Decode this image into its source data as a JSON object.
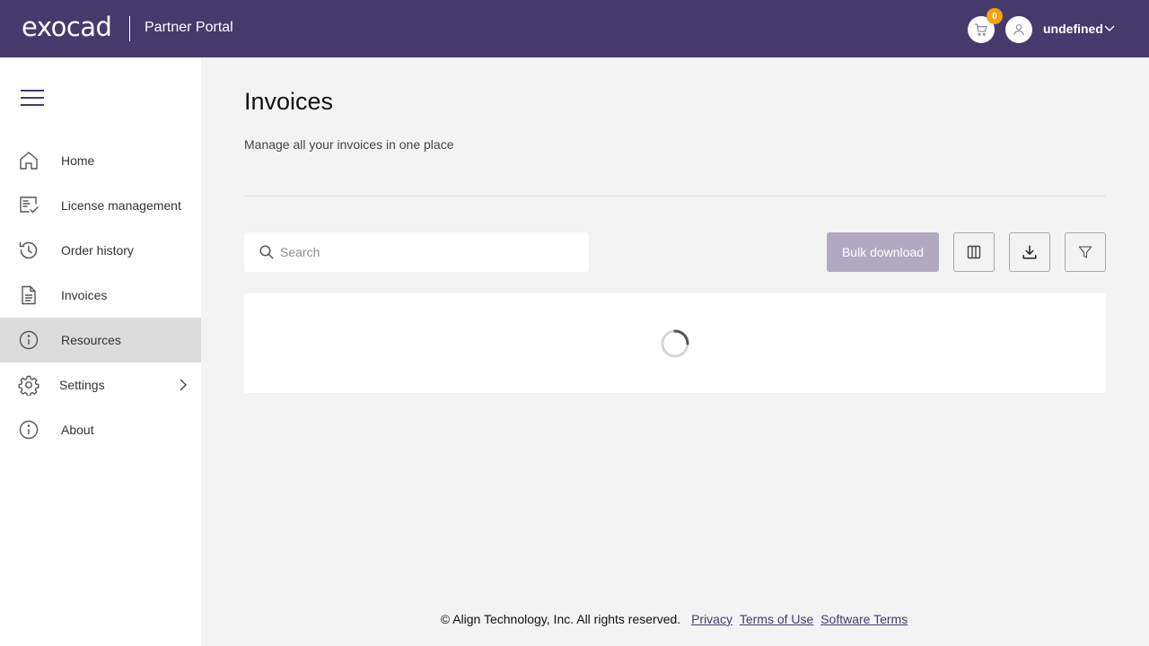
{
  "header": {
    "brand": "exocad",
    "portal_title": "Partner Portal",
    "cart_count": "0",
    "user_name": "undefined"
  },
  "sidebar": {
    "items": [
      {
        "label": "Home",
        "icon": "home-icon"
      },
      {
        "label": "License management",
        "icon": "license-icon"
      },
      {
        "label": "Order history",
        "icon": "history-icon"
      },
      {
        "label": "Invoices",
        "icon": "document-icon"
      },
      {
        "label": "Resources",
        "icon": "info-icon",
        "active": true
      },
      {
        "label": "Settings",
        "icon": "gear-icon",
        "has_submenu": true
      },
      {
        "label": "About",
        "icon": "info-icon"
      }
    ]
  },
  "main": {
    "title": "Invoices",
    "subtitle": "Manage all your invoices in one place",
    "search": {
      "placeholder": "Search",
      "value": ""
    },
    "bulk_download_label": "Bulk download"
  },
  "footer": {
    "copyright": "© Align Technology, Inc. All rights reserved.",
    "links": [
      "Privacy",
      "Terms of Use",
      "Software Terms"
    ]
  },
  "colors": {
    "header_bg": "#463a6d",
    "active_nav_bg": "#dcdcdc",
    "badge": "#f0a30a",
    "bulk_button_disabled": "#b0a9c1"
  }
}
